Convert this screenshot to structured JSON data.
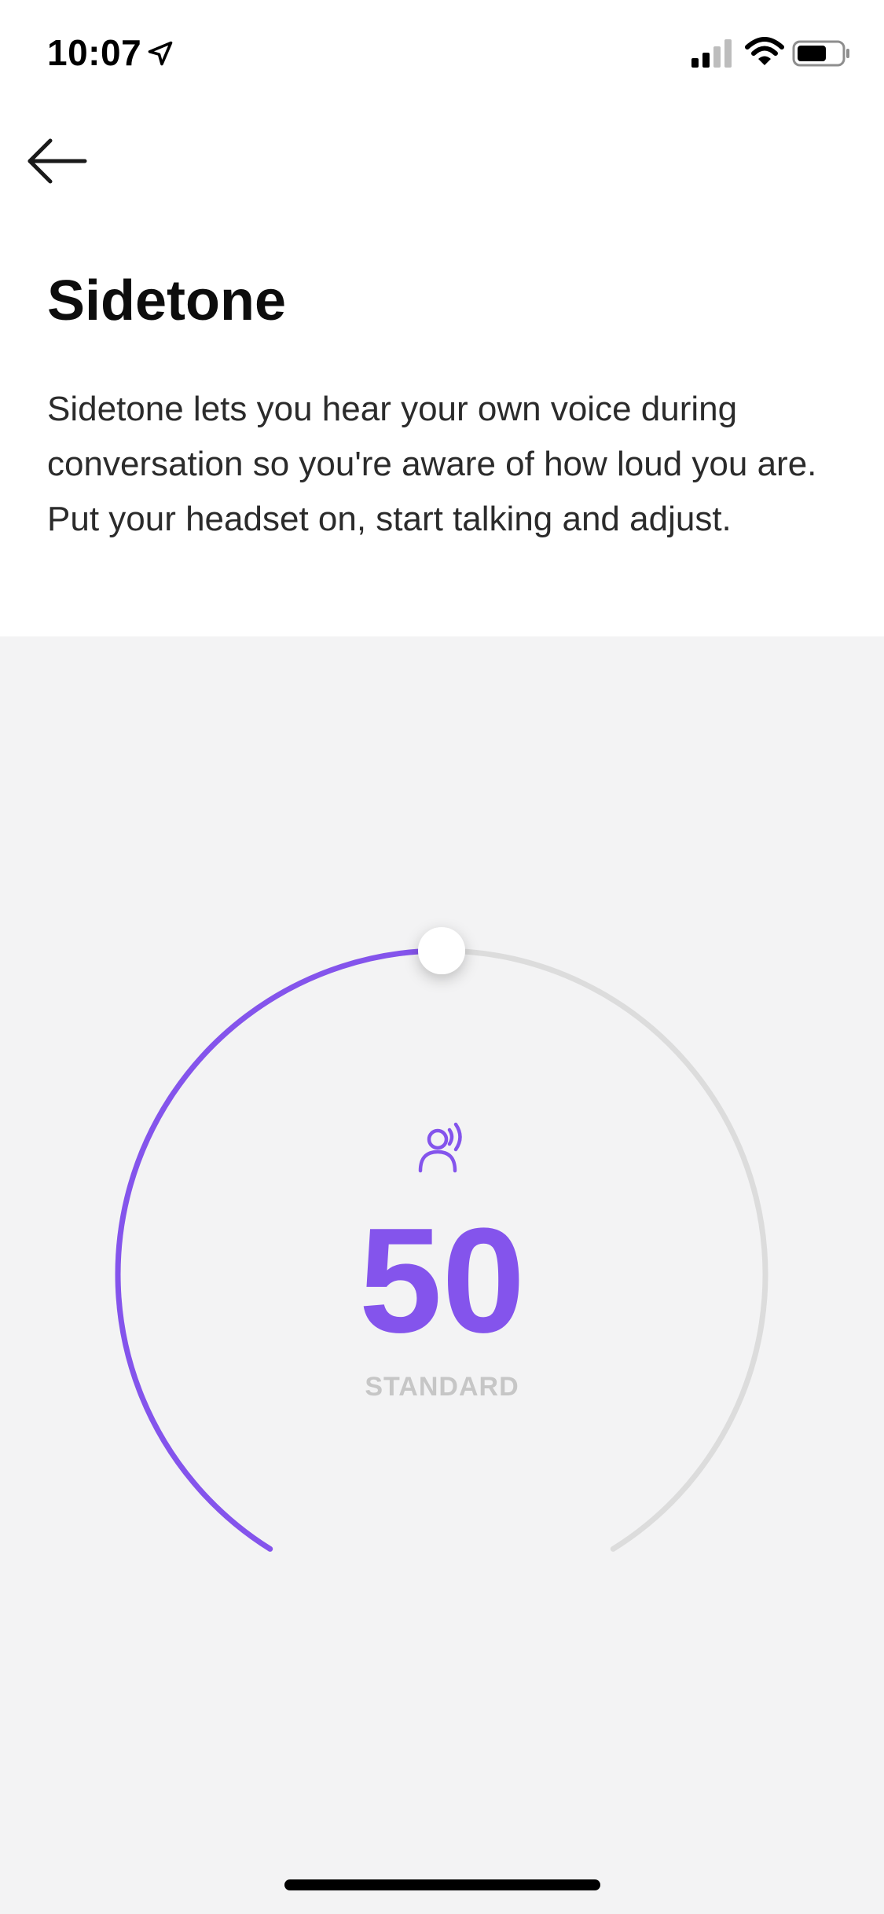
{
  "status_bar": {
    "time": "10:07",
    "icons": [
      "location-arrow-icon",
      "cellular-signal-icon",
      "wifi-icon",
      "battery-icon"
    ]
  },
  "nav": {
    "back_icon": "arrow-left-icon"
  },
  "page": {
    "title": "Sidetone",
    "description_1": "Sidetone lets you hear your own voice during conversation so you're aware of how loud you are.",
    "description_2": "Put your headset on, start talking and adjust."
  },
  "dial": {
    "value": "50",
    "mode_label": "STANDARD",
    "level_percent": 50,
    "icon": "person-voice-icon",
    "colors": {
      "accent": "#8454ec",
      "track": "#dcdcdc",
      "background": "#f3f3f4"
    }
  }
}
